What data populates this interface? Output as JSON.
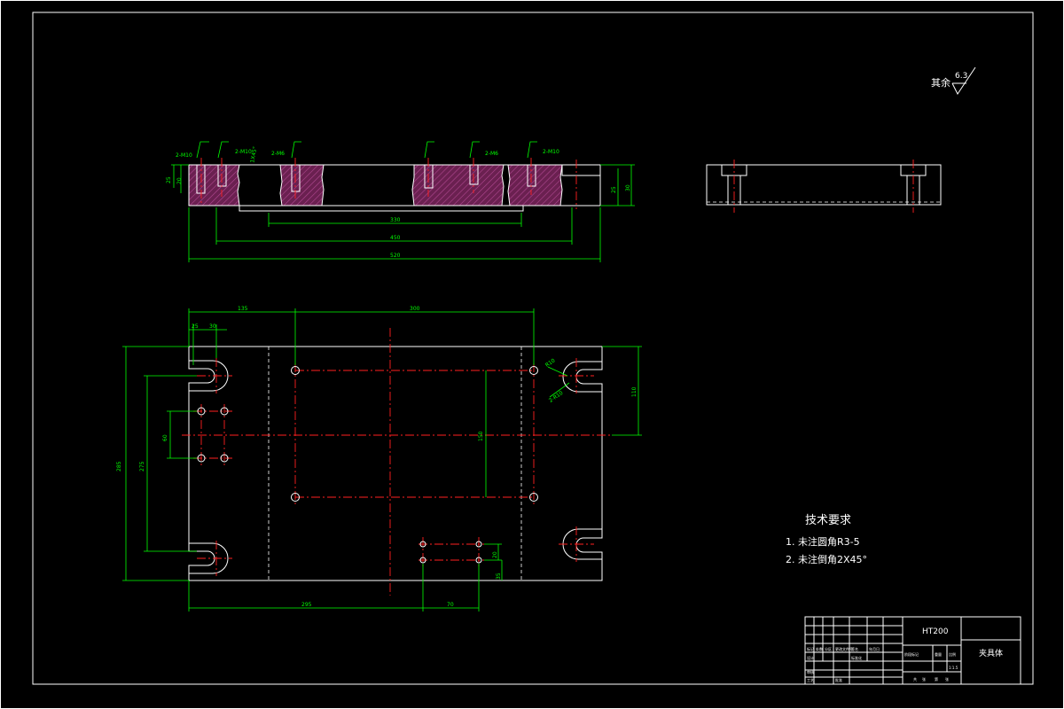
{
  "roughness": {
    "label": "其余",
    "value": "6.3"
  },
  "tech_requirements": {
    "title": "技术要求",
    "items": [
      "1. 未注圆角R3-5",
      "2. 未注倒角2X45°"
    ]
  },
  "section_view": {
    "dims": {
      "overall_width": "520",
      "inner_width": "450",
      "center_span": "330",
      "height": "30",
      "height_right": "25",
      "depth_left": "25",
      "depth_left2": "20",
      "thread_1": "2-M10",
      "thread_2": "2-M10",
      "thread_3": "2-M6",
      "thread_4": "2-M6",
      "thread_5": "2-M10",
      "chamfer": "1X45°"
    }
  },
  "plan_view": {
    "dims": {
      "top_135": "135",
      "top_300": "300",
      "left_25": "25",
      "left_30": "30",
      "height_285": "285",
      "height_275": "275",
      "hole_60": "60",
      "height_150": "150",
      "right_110": "110",
      "bottom_295": "295",
      "bottom_70": "70",
      "slot_20": "20",
      "slot_35": "35",
      "slot_r": "R10",
      "slot_angle": "2-R10"
    }
  },
  "title_block": {
    "material": "HT200",
    "part_name": "夹具体",
    "cells": [
      "标记",
      "处数",
      "分区",
      "更改文件号",
      "签名",
      "年月日",
      "设计",
      "标准化",
      "阶段标记",
      "重量",
      "比例",
      "审核",
      "工艺",
      "批准",
      "共",
      "张",
      "第",
      "张",
      "1:1.5"
    ]
  }
}
